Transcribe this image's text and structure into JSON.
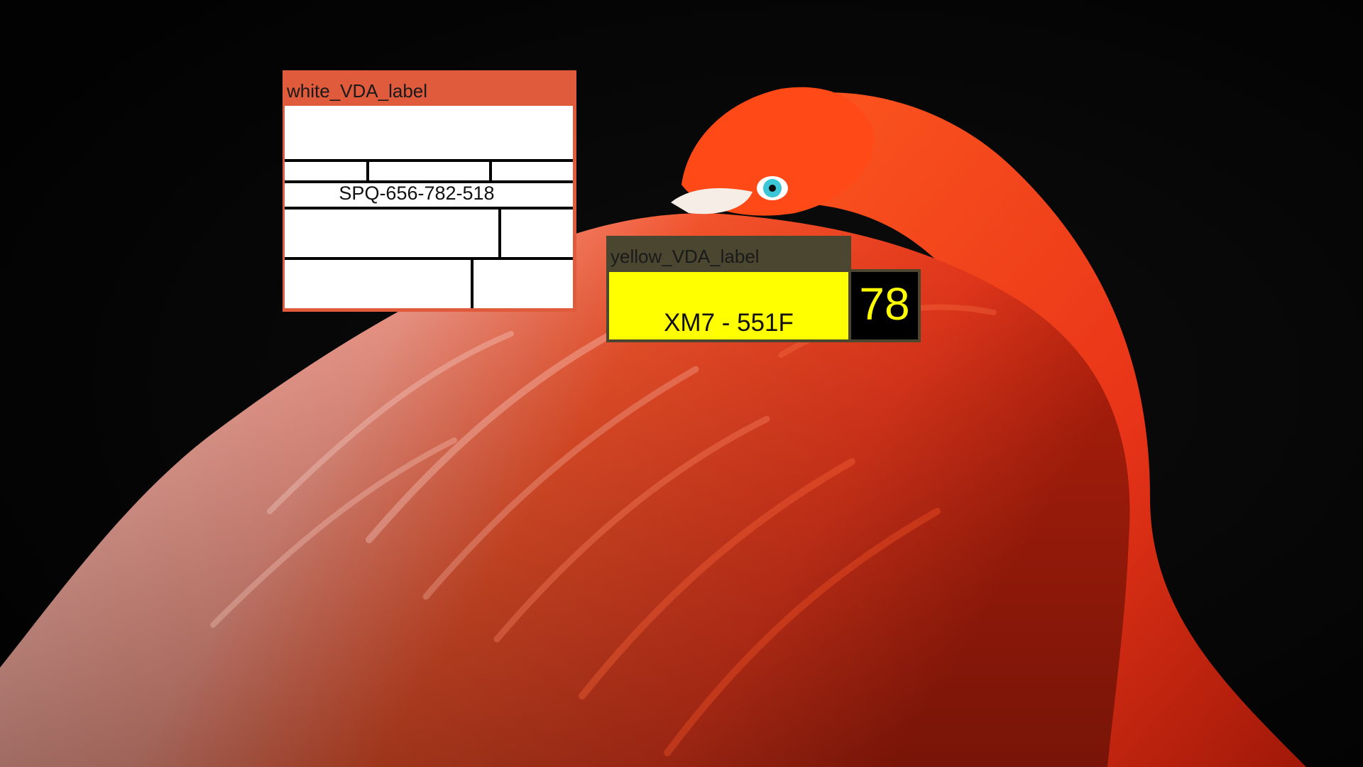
{
  "scene": {
    "subject_icon": "flamingo-icon"
  },
  "white_label": {
    "title": "white_VDA_label",
    "serial": "SPQ-656-782-518",
    "accent": "#e05a3c"
  },
  "yellow_label": {
    "title": "yellow_VDA_label",
    "plate": "XM7 - 551F",
    "count": "78",
    "accent": "#ffff00"
  }
}
